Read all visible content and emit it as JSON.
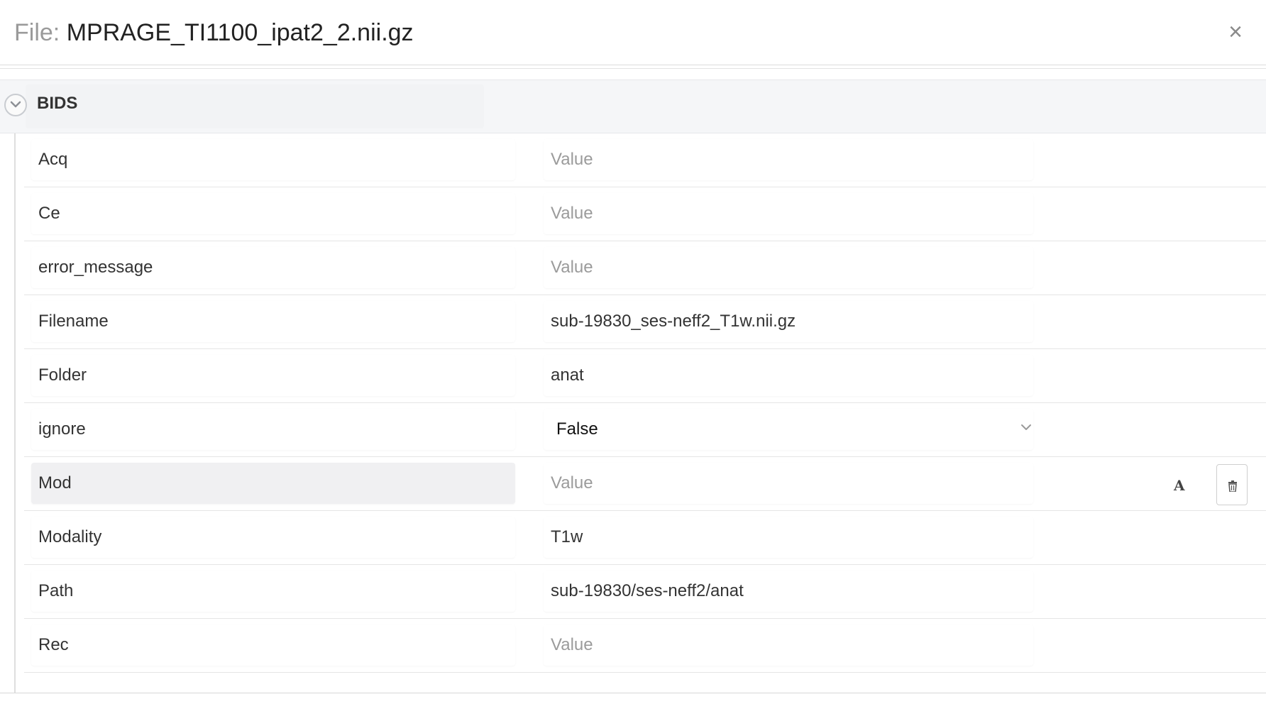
{
  "header": {
    "title_prefix": "File:",
    "file_name": "MPRAGE_TI1100_ipat2_2.nii.gz",
    "close_label": "×"
  },
  "section": {
    "title": "BIDS",
    "toggle_icon": "chevron-down-icon"
  },
  "rows": [
    {
      "key": "Acq",
      "value": "",
      "placeholder": "Value",
      "type": "text"
    },
    {
      "key": "Ce",
      "value": "",
      "placeholder": "Value",
      "type": "text"
    },
    {
      "key": "error_message",
      "value": "",
      "placeholder": "Value",
      "type": "text"
    },
    {
      "key": "Filename",
      "value": "sub-19830_ses-neff2_T1w.nii.gz",
      "placeholder": "",
      "type": "text"
    },
    {
      "key": "Folder",
      "value": "anat",
      "placeholder": "",
      "type": "text"
    },
    {
      "key": "ignore",
      "value": "False",
      "placeholder": "",
      "type": "select"
    },
    {
      "key": "Mod",
      "value": "",
      "placeholder": "Value",
      "type": "text",
      "active": true,
      "type_icon_label": "A"
    },
    {
      "key": "Modality",
      "value": "T1w",
      "placeholder": "",
      "type": "text"
    },
    {
      "key": "Path",
      "value": "sub-19830/ses-neff2/anat",
      "placeholder": "",
      "type": "text"
    },
    {
      "key": "Rec",
      "value": "",
      "placeholder": "Value",
      "type": "text"
    }
  ],
  "colors": {
    "section_bg": "#f5f6f8",
    "placeholder": "#9b9b9b",
    "text": "#333333"
  }
}
